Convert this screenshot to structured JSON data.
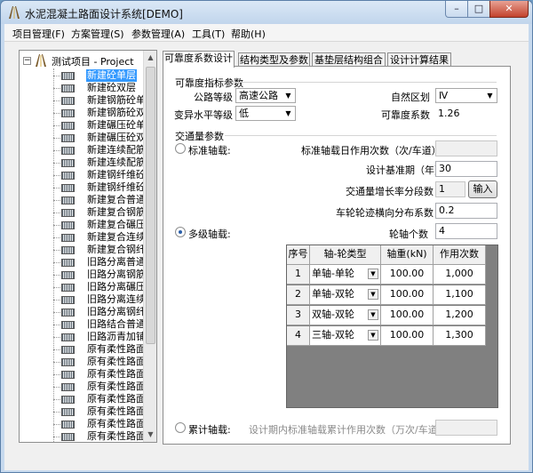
{
  "window": {
    "title": "水泥混凝土路面设计系统[DEMO]",
    "minimize": "–",
    "maximize": "□",
    "close": "✕"
  },
  "menu": [
    "项目管理(F)",
    "方案管理(S)",
    "参数管理(A)",
    "工具(T)",
    "帮助(H)"
  ],
  "tree": {
    "root_label": "测试项目 - Project",
    "expander": "−",
    "items": [
      "新建砼单层",
      "新建砼双层",
      "新建钢筋砼单层",
      "新建钢筋砼双层",
      "新建碾压砼单层",
      "新建碾压砼双层",
      "新建连续配筋砼单",
      "新建连续配筋砼双",
      "新建钢纤维砼单层",
      "新建钢纤维砼双层",
      "新建复合普通砼",
      "新建复合钢筋砼",
      "新建复合碾压砼",
      "新建复合连续配筋",
      "新建复合钢纤维砼",
      "旧路分离普通砼（",
      "旧路分离钢筋砼",
      "旧路分离碾压砼",
      "旧路分离连续配筋",
      "旧路分离钢纤维砼",
      "旧路结合普通砼",
      "旧路沥青加铺普通",
      "原有柔性路面普通",
      "原有柔性路面普通",
      "原有柔性路面钢筋",
      "原有柔性路面钢筋",
      "原有柔性路面碾压",
      "原有柔性路面碾压",
      "原有柔性路面连续",
      "原有柔性路面连续"
    ],
    "selected_index": 0
  },
  "tabs": [
    "可靠度系数设计",
    "结构类型及参数",
    "基垫层结构组合",
    "设计计算结果"
  ],
  "active_tab": 0,
  "reliability": {
    "group_title": "可靠度指标参数",
    "road_grade_label": "公路等级",
    "road_grade_value": "高速公路",
    "natural_zone_label": "自然区划",
    "natural_zone_value": "Ⅳ",
    "variability_label": "变异水平等级",
    "variability_value": "低",
    "reliability_coef_label": "可靠度系数",
    "reliability_coef_value": "1.26"
  },
  "traffic": {
    "group_title": "交通量参数",
    "standard_axle_label": "标准轴载:",
    "standard_axle_daily_label": "标准轴载日作用次数（次/车道）",
    "standard_axle_daily_value": "",
    "design_period_label": "设计基准期（年）",
    "design_period_value": "30",
    "growth_segments_label": "交通量增长率分段数",
    "growth_segments_value": "1",
    "input_button": "输入",
    "lateral_coef_label": "车轮轮迹横向分布系数",
    "lateral_coef_value": "0.2",
    "multi_axle_label": "多级轴载:",
    "axle_count_label": "轮轴个数",
    "axle_count_value": "4",
    "cumulative_label": "累计轴载:",
    "cumulative_desc": "设计期内标准轴载累计作用次数（万次/车道）",
    "cumulative_value": "",
    "selected_mode": "multi"
  },
  "axle_table": {
    "headers": [
      "序号",
      "轴-轮类型",
      "轴重(kN)",
      "作用次数"
    ],
    "rows": [
      {
        "no": "1",
        "type": "单轴-单轮",
        "load": "100.00",
        "count": "1,000"
      },
      {
        "no": "2",
        "type": "单轴-双轮",
        "load": "100.00",
        "count": "1,100"
      },
      {
        "no": "3",
        "type": "双轴-双轮",
        "load": "100.00",
        "count": "1,200"
      },
      {
        "no": "4",
        "type": "三轴-双轮",
        "load": "100.00",
        "count": "1,300"
      }
    ]
  }
}
